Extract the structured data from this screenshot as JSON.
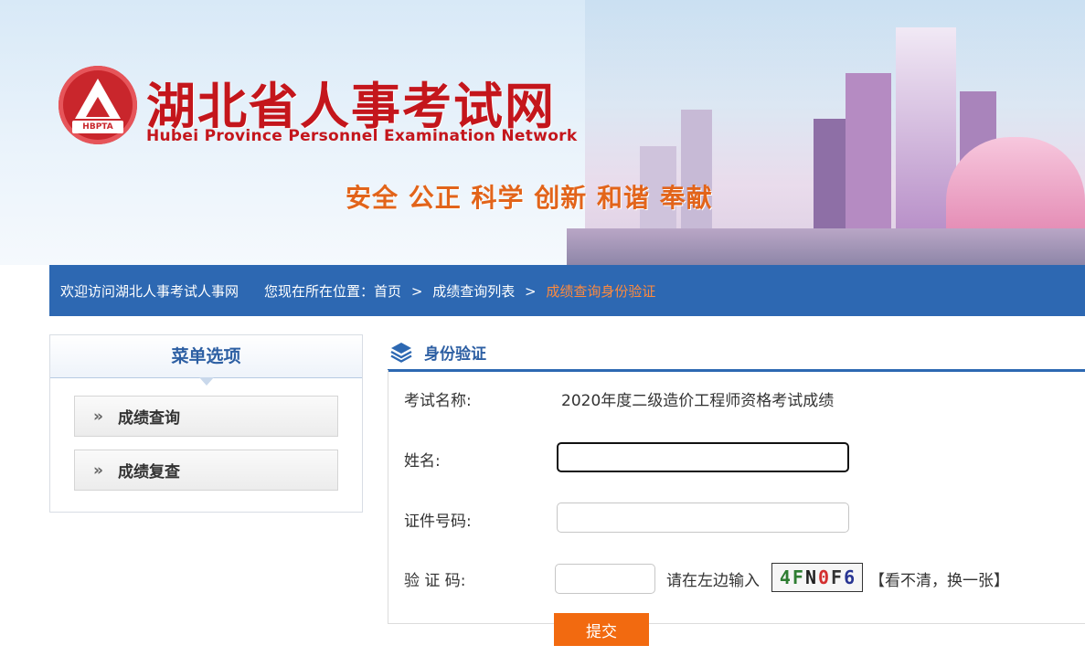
{
  "banner": {
    "title": "湖北省人事考试网",
    "subtitle": "Hubei Province Personnel Examination Network",
    "logo_abbr": "HBPTA",
    "slogan": "安全 公正 科学 创新 和谐 奉献"
  },
  "nav": {
    "welcome": "欢迎访问湖北人事考试人事网",
    "location_label": "您现在所在位置：",
    "breadcrumb": [
      "首页",
      "成绩查询列表",
      "成绩查询身份验证"
    ],
    "separator": ">",
    "current_color": "#ff8a3d"
  },
  "menu": {
    "title": "菜单选项",
    "arrow": "»",
    "items": [
      {
        "label": "成绩查询"
      },
      {
        "label": "成绩复查"
      }
    ]
  },
  "form": {
    "section_title": "身份验证",
    "exam_label": "考试名称:",
    "exam_value": "2020年度二级造价工程师资格考试成绩",
    "name_label": "姓名:",
    "name_value": "",
    "id_label": "证件号码:",
    "id_value": "",
    "captcha_label": "验 证 码:",
    "captcha_value": "",
    "captcha_hint": "请在左边输入",
    "captcha_chars": [
      {
        "ch": "4",
        "color": "#2e7d32"
      },
      {
        "ch": "F",
        "color": "#2e7d32"
      },
      {
        "ch": "N",
        "color": "#222222"
      },
      {
        "ch": "0",
        "color": "#d32f2f"
      },
      {
        "ch": "F",
        "color": "#333333"
      },
      {
        "ch": "6",
        "color": "#283593"
      }
    ],
    "refresh_text": "【看不清，换一张】",
    "submit_label": "提交"
  },
  "colors": {
    "nav_bg": "#2d68b2",
    "title_red": "#c4161c",
    "slogan_orange": "#e2641a",
    "submit_orange": "#f26a10"
  }
}
